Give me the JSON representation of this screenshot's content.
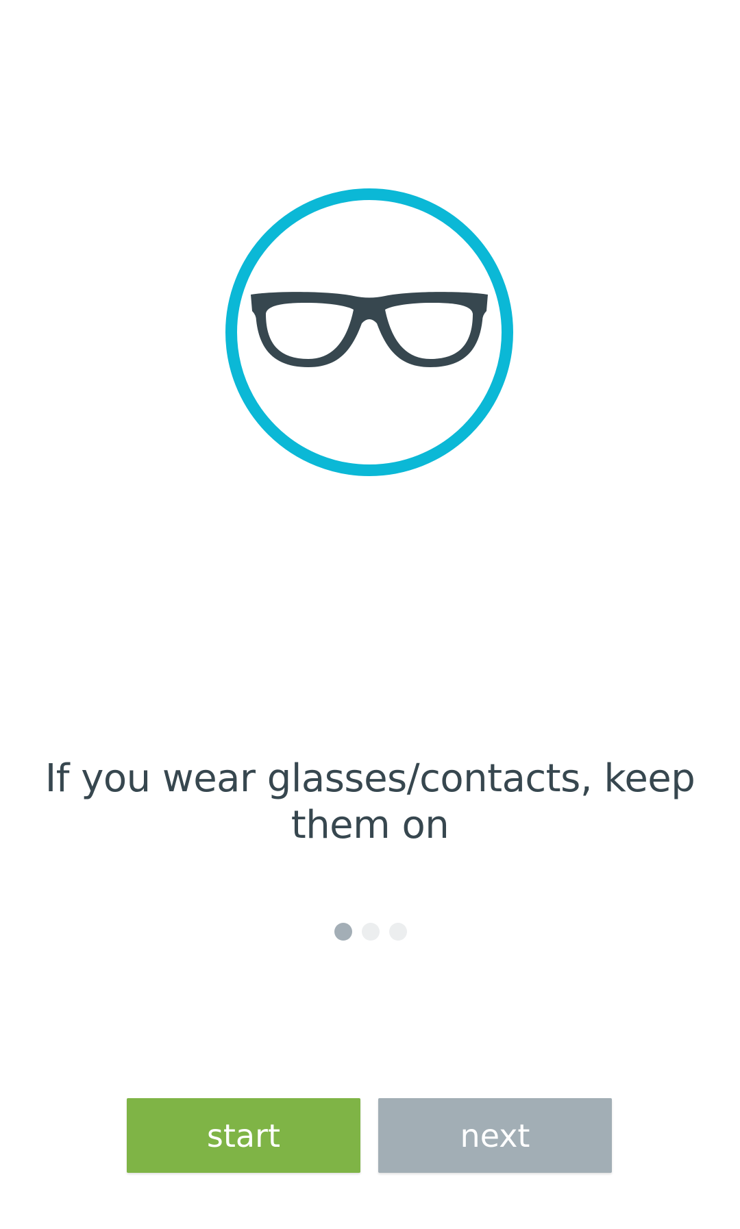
{
  "hero": {
    "icon": "glasses-icon",
    "ring_color": "#0bb8d6",
    "icon_color": "#37474f"
  },
  "message": {
    "text": "If you wear glasses/contacts, keep them on"
  },
  "pager": {
    "total": 3,
    "current": 1
  },
  "buttons": {
    "start_label": "start",
    "next_label": "next",
    "start_color": "#7fb446",
    "next_color": "#a2aeb5"
  }
}
